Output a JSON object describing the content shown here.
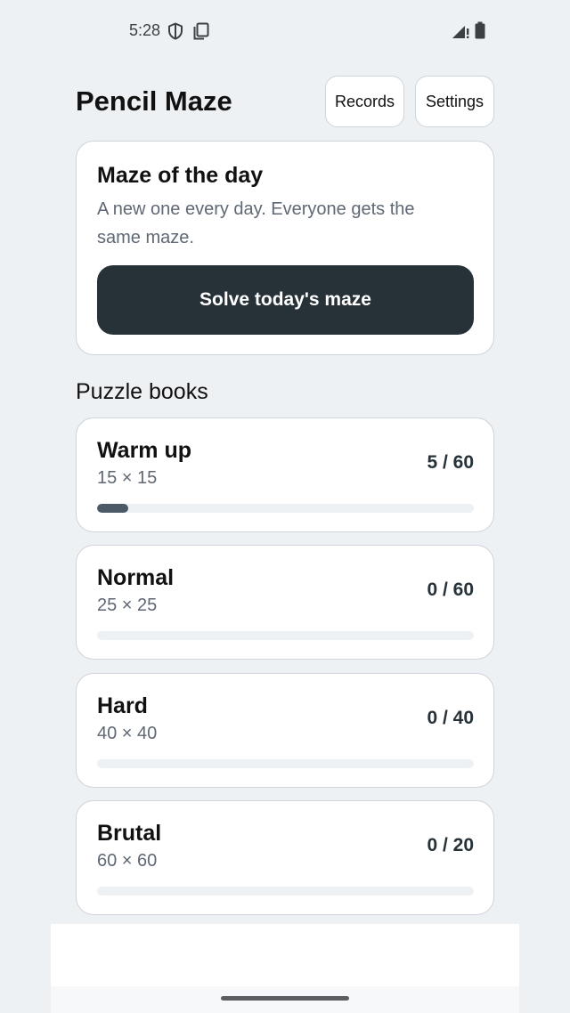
{
  "status_bar": {
    "time": "5:28",
    "icons": [
      "shield-icon",
      "copy-icon",
      "signal-icon",
      "battery-icon"
    ]
  },
  "header": {
    "title": "Pencil Maze",
    "records_label": "Records",
    "settings_label": "Settings"
  },
  "daily": {
    "title": "Maze of the day",
    "description": "A new one every day. Everyone gets the same maze.",
    "button_label": "Solve today's maze"
  },
  "books_section": {
    "title": "Puzzle books",
    "items": [
      {
        "name": "Warm up",
        "size": "15 × 15",
        "count": "5 / 60",
        "progress": 0.0833
      },
      {
        "name": "Normal",
        "size": "25 × 25",
        "count": "0 / 60",
        "progress": 0
      },
      {
        "name": "Hard",
        "size": "40 × 40",
        "count": "0 / 40",
        "progress": 0
      },
      {
        "name": "Brutal",
        "size": "60 × 60",
        "count": "0 / 20",
        "progress": 0
      }
    ]
  },
  "colors": {
    "background": "#eef1f4",
    "card": "#ffffff",
    "primary_button": "#263238",
    "progress_fill": "#4b5a66",
    "progress_track": "#eef1f4",
    "secondary_text": "#5f6874"
  }
}
